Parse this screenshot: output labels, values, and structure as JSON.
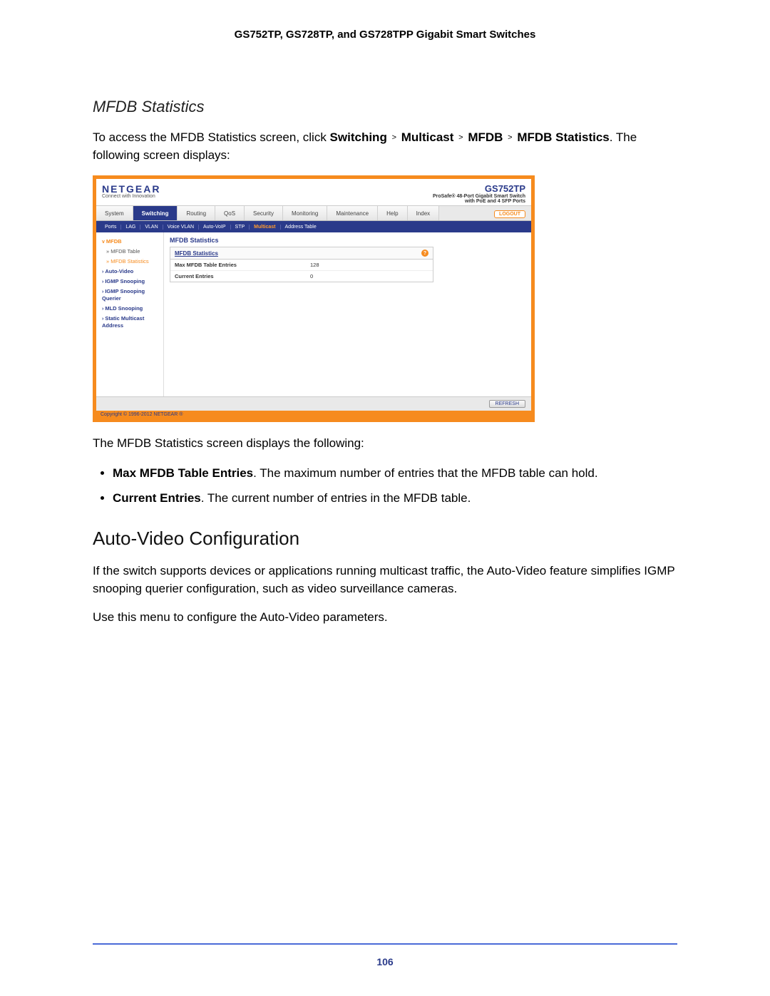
{
  "doc_header": "GS752TP, GS728TP, and GS728TPP Gigabit Smart Switches",
  "section_title": "MFDB Statistics",
  "intro_prefix": "To access the MFDB Statistics screen, click ",
  "crumbs": [
    "Switching",
    "Multicast",
    "MFDB",
    "MFDB Statistics"
  ],
  "intro_suffix": ". The following screen displays:",
  "screenshot": {
    "brand": "NETGEAR",
    "brand_tag": "Connect with Innovation",
    "model": "GS752TP",
    "model_sub1": "ProSafe® 48-Port Gigabit Smart Switch",
    "model_sub2": "with PoE and 4 SFP Ports",
    "logout": "LOGOUT",
    "top_tabs": [
      "System",
      "Switching",
      "Routing",
      "QoS",
      "Security",
      "Monitoring",
      "Maintenance",
      "Help",
      "Index"
    ],
    "top_active": "Switching",
    "sub_tabs": [
      "Ports",
      "LAG",
      "VLAN",
      "Voice VLAN",
      "Auto-VoIP",
      "STP",
      "Multicast",
      "Address Table"
    ],
    "sub_active": "Multicast",
    "side_nav": [
      {
        "label": "MFDB",
        "type": "group",
        "sel": true
      },
      {
        "label": "MFDB Table",
        "type": "sub",
        "sel": false
      },
      {
        "label": "MFDB Statistics",
        "type": "sub",
        "sel": true
      },
      {
        "label": "Auto-Video",
        "type": "group",
        "sel": false
      },
      {
        "label": "IGMP Snooping",
        "type": "group",
        "sel": false
      },
      {
        "label": "IGMP Snooping Querier",
        "type": "group",
        "sel": false
      },
      {
        "label": "MLD Snooping",
        "type": "group",
        "sel": false
      },
      {
        "label": "Static Multicast Address",
        "type": "group",
        "sel": false
      }
    ],
    "panel_title": "MFDB Statistics",
    "panel_head": "MFDB Statistics",
    "rows": [
      {
        "label": "Max MFDB Table Entries",
        "value": "128"
      },
      {
        "label": "Current Entries",
        "value": "0"
      }
    ],
    "refresh": "REFRESH",
    "copyright": "Copyright © 1996-2012 NETGEAR ®"
  },
  "after_shot": "The MFDB Statistics screen displays the following:",
  "bullets": [
    {
      "bold": "Max MFDB Table Entries",
      "rest": ". The maximum number of entries that the MFDB table can hold."
    },
    {
      "bold": "Current Entries",
      "rest": ". The current number of entries in the MFDB table."
    }
  ],
  "h2": "Auto-Video Configuration",
  "p1": "If the switch supports devices or applications running multicast traffic, the Auto-Video feature simplifies IGMP snooping querier configuration, such as video surveillance cameras.",
  "p2": "Use this menu to configure the Auto-Video parameters.",
  "page_num": "106"
}
